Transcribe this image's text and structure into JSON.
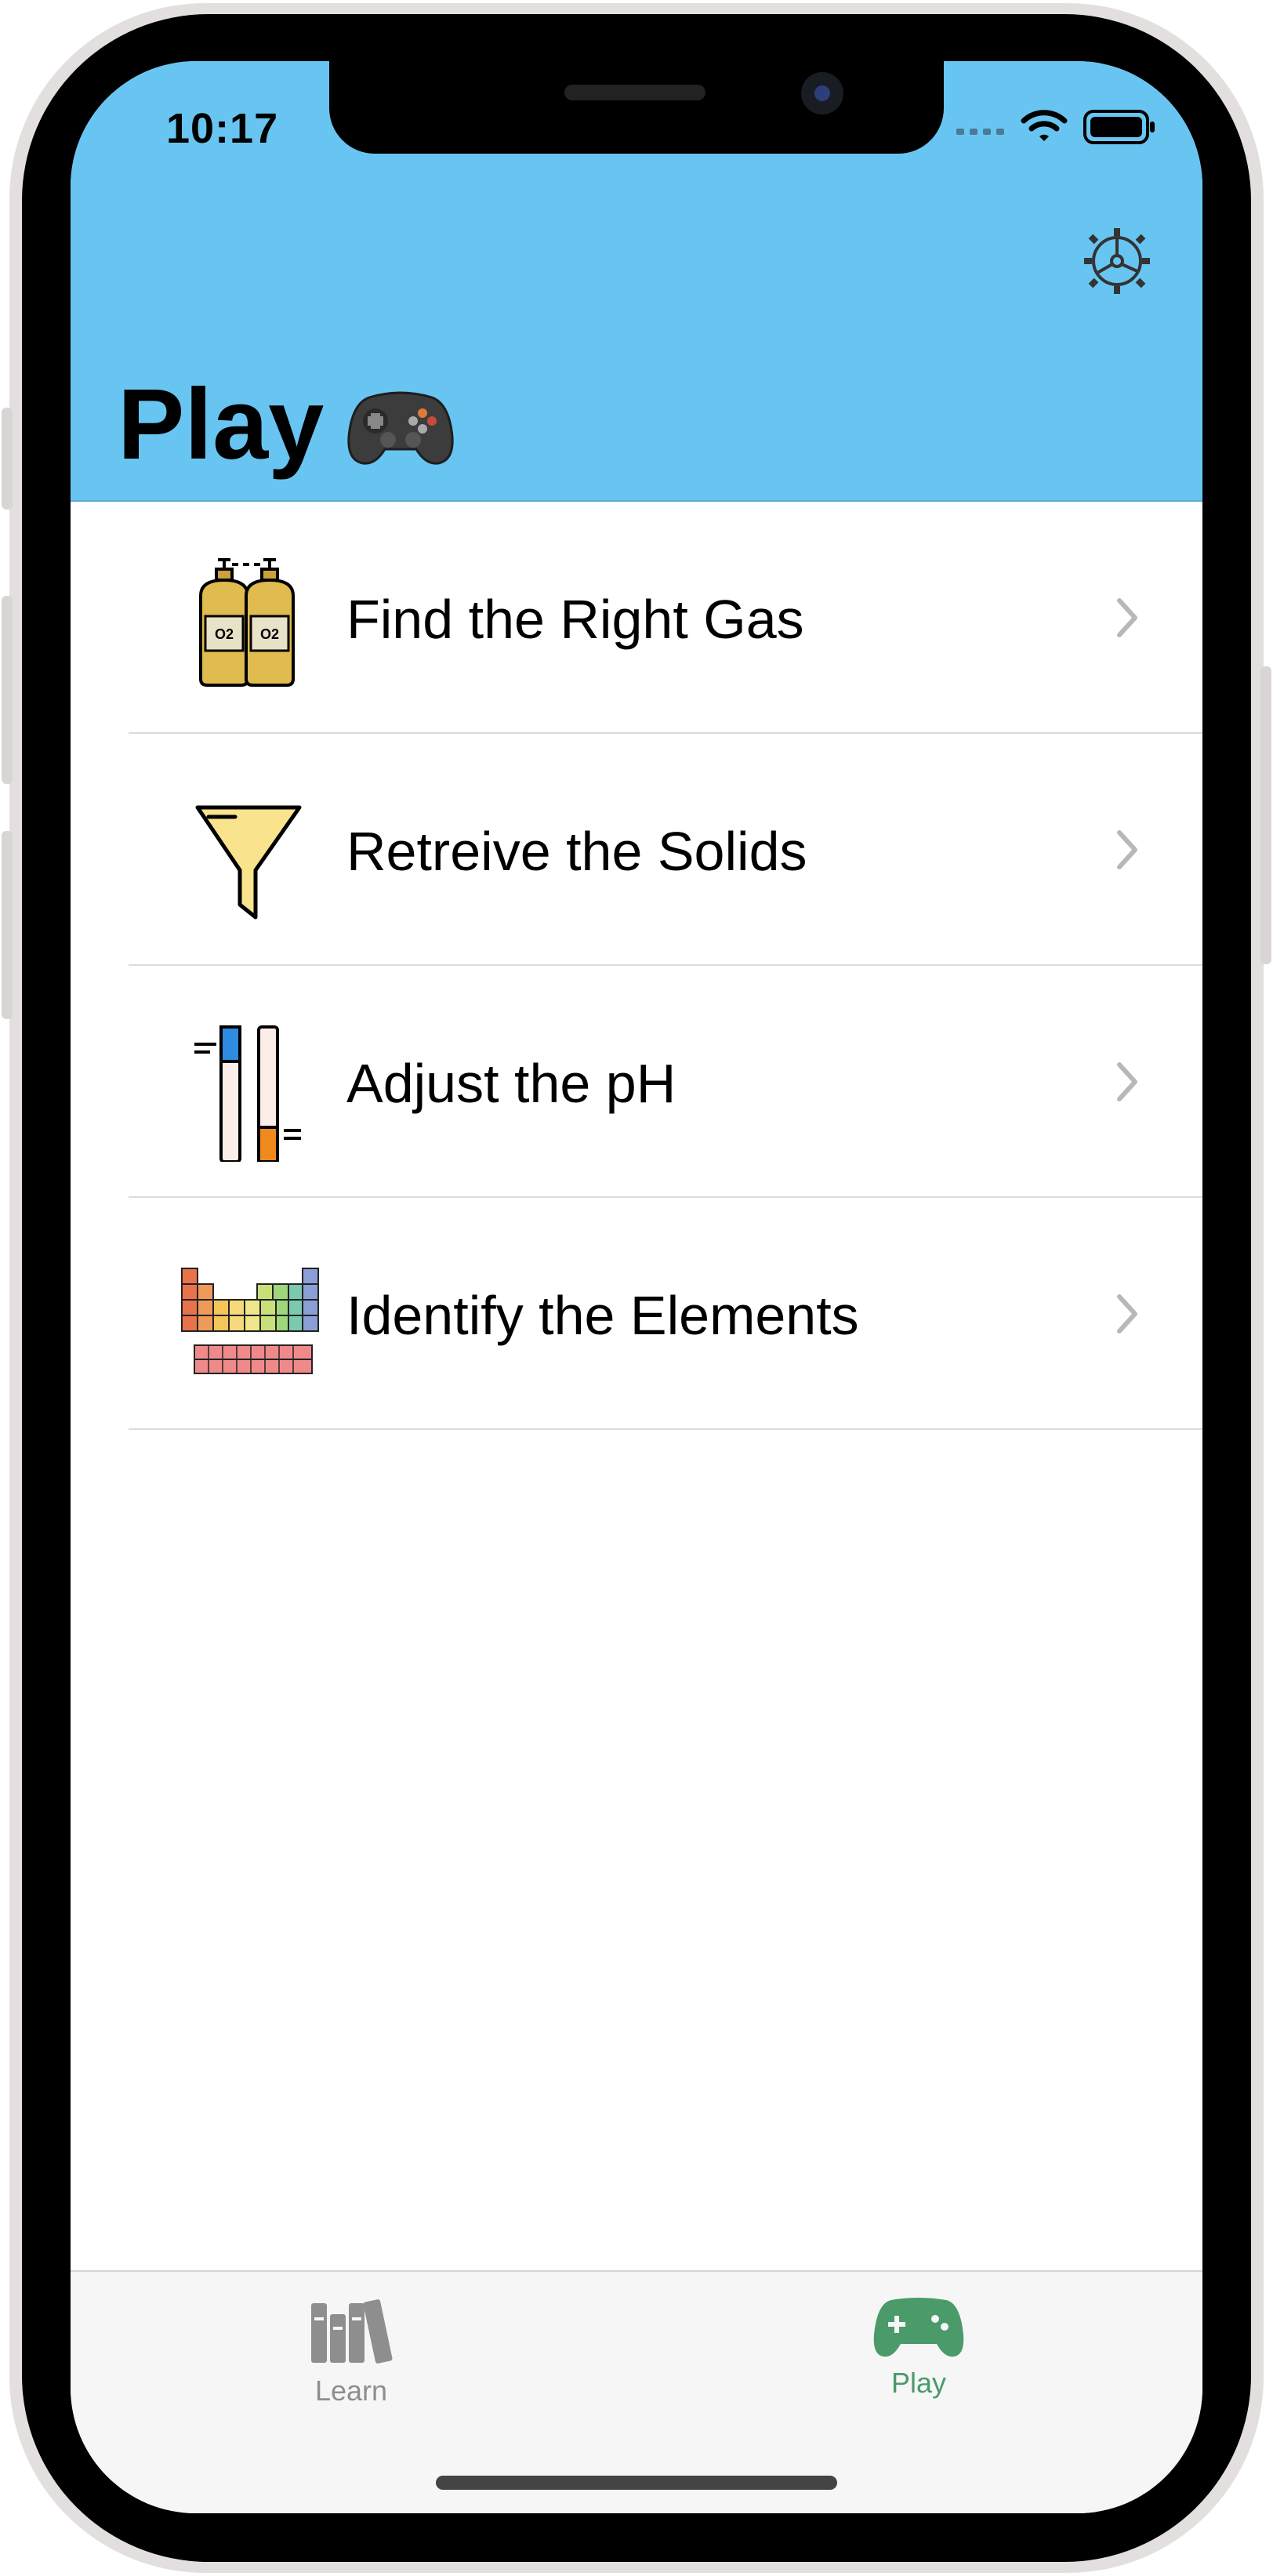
{
  "status_bar": {
    "time": "10:17"
  },
  "header": {
    "title": "Play",
    "title_emoji": "🎮"
  },
  "colors": {
    "header_bg": "#68c5f2",
    "tab_active": "#4a9a6a",
    "tab_inactive": "#8e8e8e"
  },
  "list": {
    "items": [
      {
        "label": "Find the Right Gas",
        "icon": "oxygen-tanks-icon"
      },
      {
        "label": "Retreive the Solids",
        "icon": "funnel-icon"
      },
      {
        "label": "Adjust the pH",
        "icon": "ph-tubes-icon"
      },
      {
        "label": "Identify the Elements",
        "icon": "periodic-table-icon"
      }
    ]
  },
  "tabbar": {
    "tabs": [
      {
        "label": "Learn",
        "icon": "books-icon",
        "active": false
      },
      {
        "label": "Play",
        "icon": "gamepad-icon",
        "active": true
      }
    ]
  }
}
